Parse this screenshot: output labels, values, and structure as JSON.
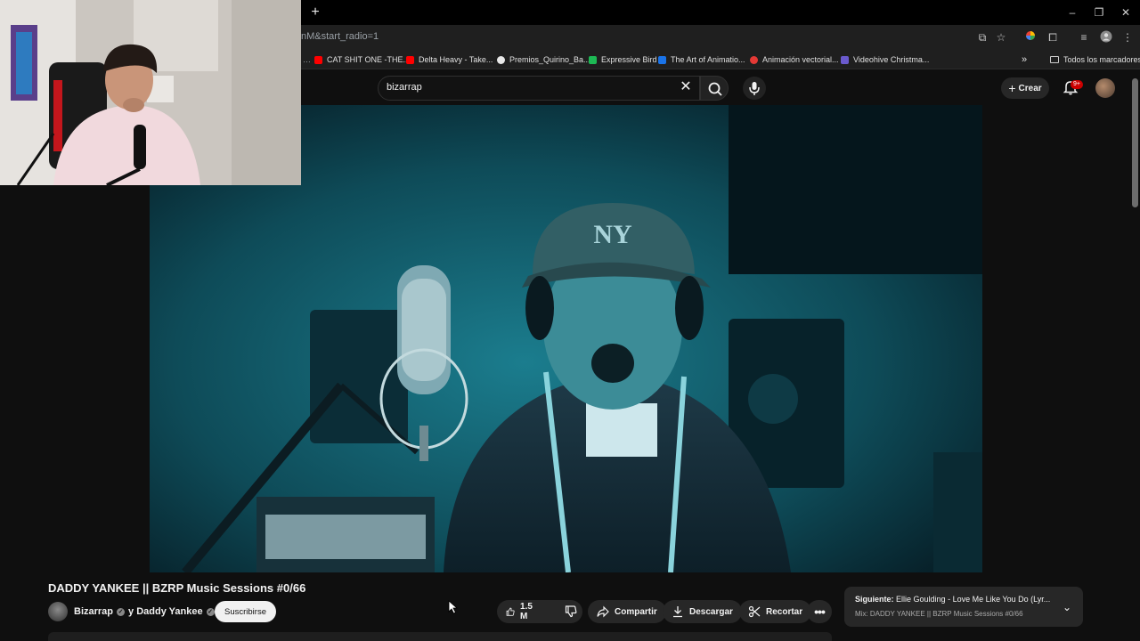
{
  "browser": {
    "url_fragment": "nM&start_radio=1",
    "new_tab_icon": "plus-icon",
    "bookmarks": [
      {
        "label": "CAT SHIT ONE -THE...",
        "color": "#ff0000"
      },
      {
        "label": "Delta Heavy - Take...",
        "color": "#ff0000"
      },
      {
        "label": "Premios_Quirino_Ba...",
        "color": "#e8e8e8"
      },
      {
        "label": "Expressive Bird",
        "color": "#1db954"
      },
      {
        "label": "The Art of Animatio...",
        "color": "#1a73e8"
      },
      {
        "label": "Animación vectorial...",
        "color": "#e53935"
      },
      {
        "label": "Videohive Christma...",
        "color": "#6a5acd"
      }
    ],
    "all_bookmarks_label": "Todos los marcadores"
  },
  "youtube": {
    "search_value": "bizarrap",
    "create_label": "Crear",
    "notification_badge": "9+"
  },
  "video": {
    "title": "DADDY YANKEE || BZRP Music Sessions #0/66",
    "channel_name": "Bizarrap",
    "channel_connector": "y Daddy Yankee",
    "subscribe_label": "Suscribirse",
    "likes": "1.5 M",
    "share_label": "Compartir",
    "download_label": "Descargar",
    "clip_label": "Recortar"
  },
  "up_next": {
    "prefix": "Siguiente:",
    "title": "Ellie Goulding - Love Me Like You Do (Lyr...",
    "mix_label": "Mix: DADDY YANKEE || BZRP Music Sessions #0/66"
  },
  "colors": {
    "background": "#0f0f0f",
    "pill": "#272727",
    "badge": "#cc0000"
  }
}
